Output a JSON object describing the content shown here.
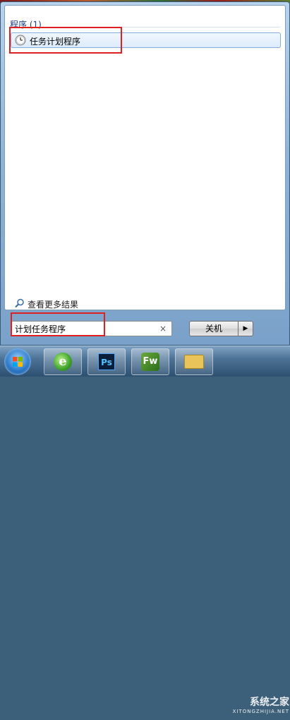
{
  "start_menu": {
    "section_header": "程序 (1)",
    "results": [
      {
        "label": "任务计划程序",
        "icon": "clock-icon"
      }
    ],
    "see_more_label": "查看更多结果",
    "search": {
      "value": "计划任务程序",
      "clear_glyph": "×"
    },
    "shutdown": {
      "label": "关机",
      "arrow_glyph": "▶"
    }
  },
  "taskbar": {
    "buttons": [
      {
        "name": "internet-explorer",
        "glyph": "e"
      },
      {
        "name": "photoshop",
        "glyph": "Ps"
      },
      {
        "name": "fireworks",
        "glyph": "Fw"
      },
      {
        "name": "windows-explorer",
        "glyph": ""
      }
    ]
  },
  "watermark": {
    "text": "系统之家",
    "sub": "XITONGZHIJIA.NET"
  },
  "colors": {
    "highlight_box": "#e02020",
    "section_header": "#1e3c8c"
  }
}
